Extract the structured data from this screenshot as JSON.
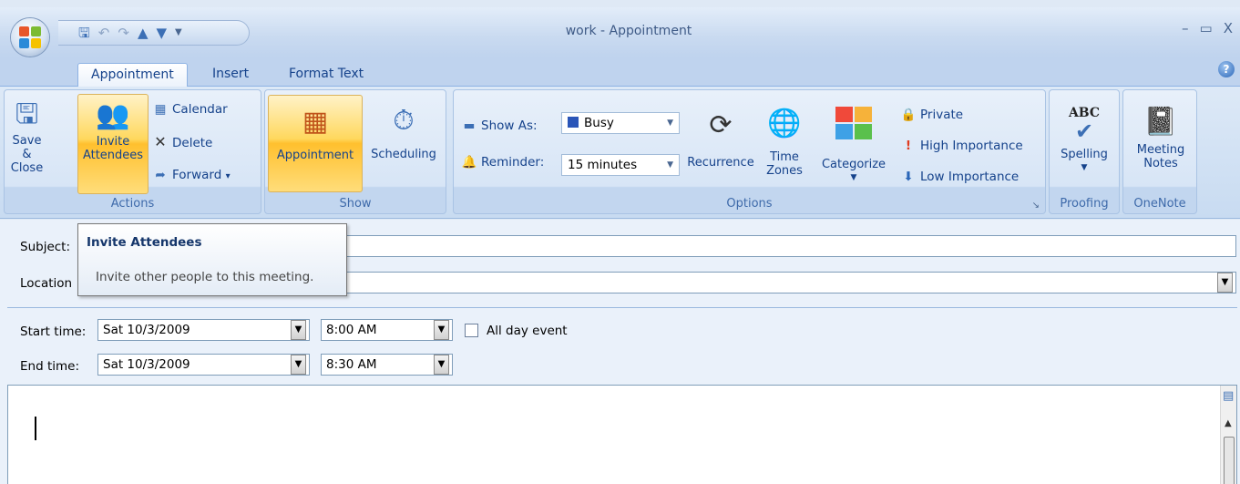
{
  "window": {
    "title": "work - Appointment",
    "minimize": "–",
    "maximize": "▭",
    "close": "X"
  },
  "quick_access": {
    "save_icon": "save-icon",
    "undo_icon": "undo-icon",
    "redo_icon": "redo-icon",
    "up_icon": "previous-item-icon",
    "down_icon": "next-item-icon",
    "customize": "▼"
  },
  "tabs": [
    "Appointment",
    "Insert",
    "Format Text"
  ],
  "help": "?",
  "ribbon": {
    "actions": {
      "label": "Actions",
      "save_close": [
        "Save &",
        "Close"
      ],
      "invite": [
        "Invite",
        "Attendees"
      ],
      "calendar": "Calendar",
      "delete": "Delete",
      "forward": "Forward",
      "forward_arrow": "▾"
    },
    "show": {
      "label": "Show",
      "appointment": "Appointment",
      "scheduling": "Scheduling"
    },
    "options": {
      "label": "Options",
      "show_as_label": "Show As:",
      "show_as_value": "Busy",
      "reminder_label": "Reminder:",
      "reminder_value": "15 minutes",
      "recurrence": "Recurrence",
      "time_zones": [
        "Time",
        "Zones"
      ],
      "categorize": "Categorize",
      "private": "Private",
      "high_importance": "High Importance",
      "low_importance": "Low Importance",
      "launcher": "↘"
    },
    "proofing": {
      "label": "Proofing",
      "spelling": "Spelling",
      "abc": "ABC"
    },
    "onenote": {
      "label": "OneNote",
      "meeting_notes": [
        "Meeting",
        "Notes"
      ]
    }
  },
  "form": {
    "subject_label": "Subject:",
    "subject_value": "",
    "location_label": "Location",
    "location_value": "",
    "start_label": "Start time:",
    "start_date": "Sat 10/3/2009",
    "start_time": "8:00 AM",
    "end_label": "End time:",
    "end_date": "Sat 10/3/2009",
    "end_time": "8:30 AM",
    "all_day_label": "All day event",
    "all_day_checked": false,
    "combo_arrow": "▼"
  },
  "tooltip": {
    "title": "Invite Attendees",
    "description": "Invite other people to this meeting."
  },
  "colors": {
    "ribbon_bg": "#c8dbf1",
    "hot_button": "#ffc02e",
    "text": "#15428b"
  }
}
